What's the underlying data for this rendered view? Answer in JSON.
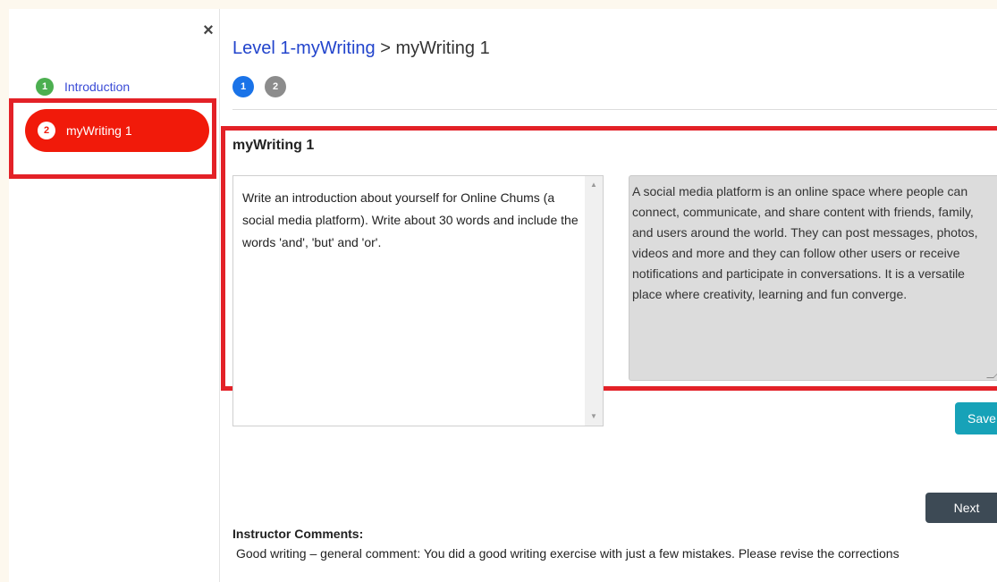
{
  "sidebar": {
    "close_glyph": "×",
    "items": [
      {
        "number": "1",
        "label": "Introduction"
      },
      {
        "number": "2",
        "label": "myWriting 1"
      }
    ]
  },
  "breadcrumb": {
    "link": "Level 1-myWriting",
    "separator": " > ",
    "current": "myWriting 1"
  },
  "steps": [
    "1",
    "2"
  ],
  "section": {
    "title": "myWriting 1",
    "prompt": "Write an introduction about yourself for Online Chums (a social media platform). Write about 30 words and include the words 'and', 'but' and 'or'.",
    "response": "A social media platform is an online space where people can connect, communicate, and share content with friends, family, and users around the world. They can post messages, photos, videos and more and they can follow other users or receive notifications and participate in conversations. It is a versatile place where creativity, learning and fun converge."
  },
  "buttons": {
    "save": "Save",
    "next": "Next"
  },
  "comments": {
    "title": "Instructor Comments:",
    "text": "Good writing – general comment: You did a good writing exercise with just a few mistakes. Please revise the corrections"
  },
  "colors": {
    "highlight": "#e32127",
    "active_item": "#f11a0a",
    "intro_badge": "#4caf50",
    "link": "#2244cc",
    "step_active": "#1a73e8",
    "save": "#17a2b8",
    "next": "#3d4a55"
  }
}
